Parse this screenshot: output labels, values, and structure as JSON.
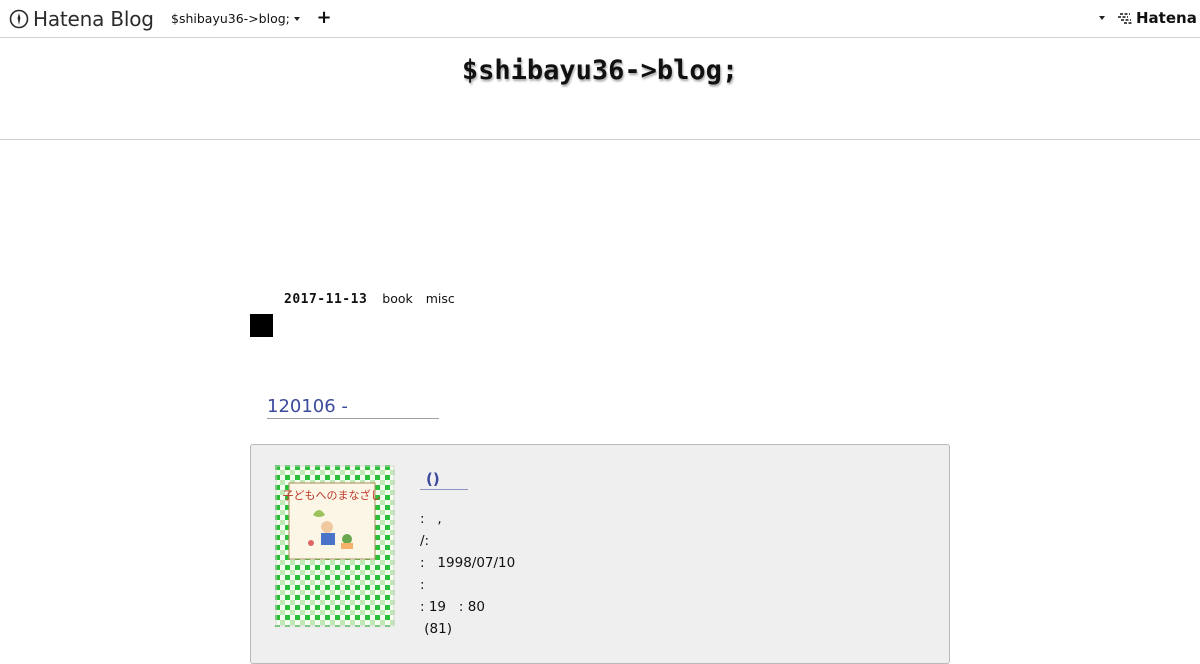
{
  "topbar": {
    "brand": "Hatena Blog",
    "blog_switch": "$shibayu36->blog;",
    "plus": "+",
    "hatena": "Hatena"
  },
  "blog": {
    "title": "$shibayu36->blog;"
  },
  "entry": {
    "date": "2017-11-13",
    "categories": [
      "book",
      "misc"
    ],
    "title": "120106 -"
  },
  "item": {
    "title": "()",
    "cover_title": "子どもへのまなざし",
    "lines": [
      ":   ,",
      "/:",
      ":   1998/07/10",
      ":",
      ": 19   : 80",
      " (81)"
    ]
  },
  "colors": {
    "link": "#3c4a9b",
    "box_bg": "#efefef",
    "cover_green": "#2bbf3a"
  }
}
